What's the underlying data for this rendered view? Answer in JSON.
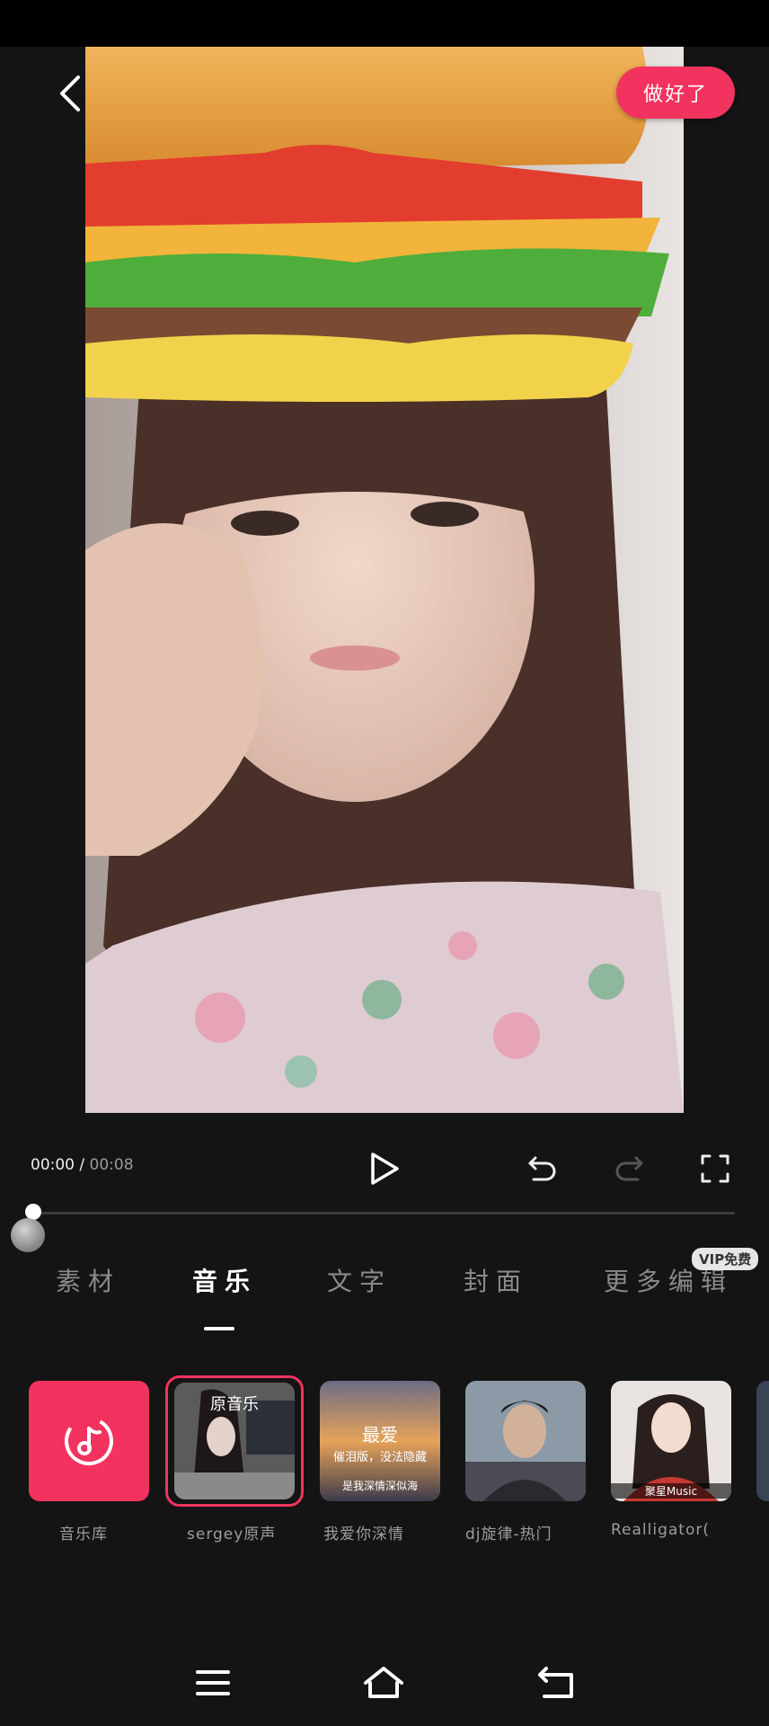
{
  "header": {
    "done_label": "做好了"
  },
  "player": {
    "current_time": "00:00",
    "separator": " / ",
    "total_time": "00:08"
  },
  "tabs": [
    {
      "label": "素材"
    },
    {
      "label": "音乐"
    },
    {
      "label": "文字"
    },
    {
      "label": "封面"
    },
    {
      "label": "更多编辑"
    }
  ],
  "active_tab": "音乐",
  "vip_badge": "VIP免费",
  "music": {
    "library_label": "音乐库",
    "items": [
      {
        "label": "sergey原声",
        "overlay": "原音乐"
      },
      {
        "label": "我爱你深情",
        "overlay_title": "最爱",
        "overlay_sub": "催泪版，没法隐藏",
        "overlay_sub2": "是我深情深似海"
      },
      {
        "label": "dj旋律-热门"
      },
      {
        "label": "Realligator(",
        "overlay": "聚星Music"
      }
    ]
  },
  "colors": {
    "accent": "#f2335f",
    "background": "#141414"
  },
  "icons": [
    "back-arrow-icon",
    "play-icon",
    "undo-icon",
    "redo-icon",
    "fullscreen-icon",
    "music-note-icon",
    "menu-icon",
    "home-icon",
    "return-icon"
  ]
}
